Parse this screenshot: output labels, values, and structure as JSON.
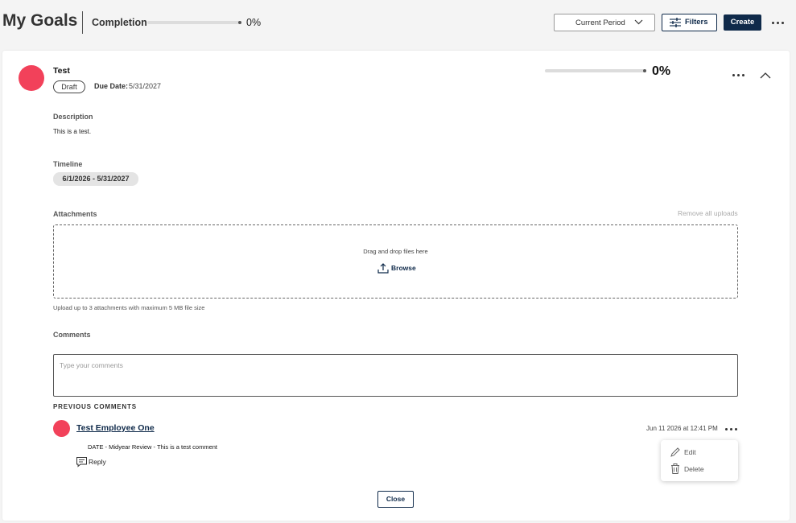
{
  "header": {
    "title": "My Goals",
    "completion_label": "Completion",
    "completion_value": "0%",
    "completion_fraction": 0,
    "period_select": "Current Period",
    "filters_label": "Filters",
    "create_label": "Create"
  },
  "goal": {
    "name": "Test",
    "status": "Draft",
    "due_label": "Due Date:",
    "due_value": "5/31/2027",
    "progress_value": "0%",
    "progress_fraction": 0,
    "description_label": "Description",
    "description_text": "This is a test.",
    "timeline_label": "Timeline",
    "timeline_value": "6/1/2026 - 5/31/2027",
    "attachments_label": "Attachments",
    "remove_uploads": "Remove all uploads",
    "drop_text": "Drag and drop files here",
    "browse_label": "Browse",
    "upload_hint": "Upload up to 3 attachments with maximum 5 MB file size",
    "comments_label": "Comments",
    "comment_placeholder": "Type your comments",
    "previous_comments_label": "PREVIOUS COMMENTS",
    "comments": [
      {
        "author": "Test Employee One",
        "timestamp": "Jun 11 2026 at 12:41 PM",
        "text": "DATE - Midyear Review - This is a test comment",
        "reply_label": "Reply"
      }
    ],
    "comment_menu": {
      "edit_label": "Edit",
      "delete_label": "Delete"
    },
    "close_label": "Close"
  },
  "colors": {
    "primary": "#0f2a4a",
    "avatar": "#f2415a",
    "background": "#f4f4f4"
  }
}
